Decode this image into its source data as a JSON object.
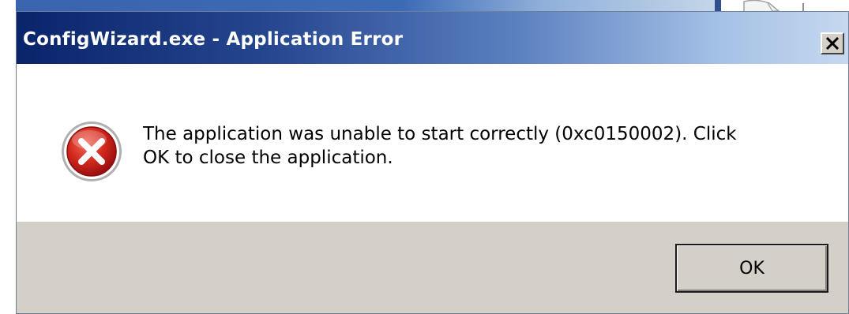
{
  "dialog": {
    "title": "ConfigWizard.exe - Application Error",
    "message_line1": "The application was unable to start correctly (0xc0150002). Click",
    "message_line2": "OK to close the application.",
    "ok_label": "OK",
    "close_label": "×"
  },
  "icons": {
    "error": "error-icon",
    "close": "close-icon"
  },
  "colors": {
    "title_bar_start": "#0a246a",
    "title_bar_end": "#c5d8ee",
    "error_red": "#c82020",
    "button_face": "#d4d0c8"
  }
}
